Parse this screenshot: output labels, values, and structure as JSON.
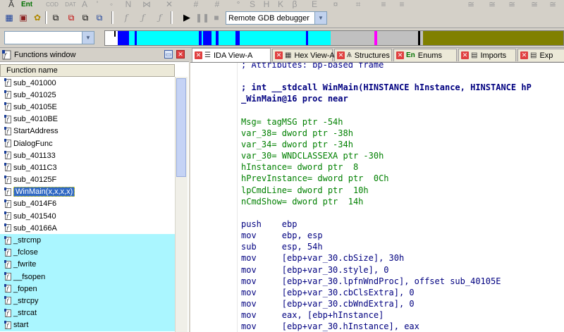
{
  "toolbar": {
    "debugger_combo": "Remote GDB debugger",
    "row1_labels": [
      "Ent",
      "COD",
      "DAT"
    ]
  },
  "functions_window": {
    "title": "Functions window",
    "column_header": "Function name",
    "items": [
      {
        "name": "sub_401000",
        "lib": false
      },
      {
        "name": "sub_401025",
        "lib": false
      },
      {
        "name": "sub_40105E",
        "lib": false
      },
      {
        "name": "sub_4010BE",
        "lib": false
      },
      {
        "name": "StartAddress",
        "lib": false
      },
      {
        "name": "DialogFunc",
        "lib": false
      },
      {
        "name": "sub_401133",
        "lib": false
      },
      {
        "name": "sub_4011C3",
        "lib": false
      },
      {
        "name": "sub_40125F",
        "lib": false
      },
      {
        "name": "WinMain(x,x,x,x)",
        "lib": false,
        "selected": true
      },
      {
        "name": "sub_4014F6",
        "lib": false
      },
      {
        "name": "sub_401540",
        "lib": false
      },
      {
        "name": "sub_40166A",
        "lib": false
      },
      {
        "name": "_strcmp",
        "lib": true
      },
      {
        "name": "_fclose",
        "lib": true
      },
      {
        "name": "_fwrite",
        "lib": true
      },
      {
        "name": "__fsopen",
        "lib": true
      },
      {
        "name": "_fopen",
        "lib": true
      },
      {
        "name": "_strcpy",
        "lib": true
      },
      {
        "name": "_strcat",
        "lib": true
      },
      {
        "name": "start",
        "lib": true
      }
    ]
  },
  "tabs": [
    {
      "label": "IDA View-A",
      "glyph": "☰",
      "active": true
    },
    {
      "label": "Hex View-A",
      "glyph": "▦",
      "active": false
    },
    {
      "label": "Structures",
      "glyph": "Ѧ",
      "active": false
    },
    {
      "label": "Enums",
      "glyph": "En",
      "active": false
    },
    {
      "label": "Imports",
      "glyph": "▤",
      "active": false
    },
    {
      "label": "Exp",
      "glyph": "▤",
      "active": false
    }
  ],
  "code": [
    {
      "text": "; Attributes: bp-based frame",
      "cls": "c-cmt"
    },
    {
      "text": "",
      "cls": ""
    },
    {
      "text": "; int __stdcall WinMain(HINSTANCE hInstance, HINSTANCE hP",
      "cls": "c-hdr"
    },
    {
      "text": "_WinMain@16 proc near",
      "cls": "c-hdr"
    },
    {
      "text": "",
      "cls": ""
    },
    {
      "text": "Msg= tagMSG ptr -54h",
      "cls": "c-var"
    },
    {
      "text": "var_38= dword ptr -38h",
      "cls": "c-var"
    },
    {
      "text": "var_34= dword ptr -34h",
      "cls": "c-var"
    },
    {
      "text": "var_30= WNDCLASSEXA ptr -30h",
      "cls": "c-var"
    },
    {
      "text": "hInstance= dword ptr  8",
      "cls": "c-var"
    },
    {
      "text": "hPrevInstance= dword ptr  0Ch",
      "cls": "c-var"
    },
    {
      "text": "lpCmdLine= dword ptr  10h",
      "cls": "c-var"
    },
    {
      "text": "nCmdShow= dword ptr  14h",
      "cls": "c-var"
    },
    {
      "text": "",
      "cls": ""
    },
    {
      "text": "push    ebp",
      "cls": "c-ins"
    },
    {
      "text": "mov     ebp, esp",
      "cls": "c-ins"
    },
    {
      "text": "sub     esp, 54h",
      "cls": "c-ins"
    },
    {
      "text": "mov     [ebp+var_30.cbSize], 30h",
      "cls": "c-ins"
    },
    {
      "text": "mov     [ebp+var_30.style], 0",
      "cls": "c-ins"
    },
    {
      "text": "mov     [ebp+var_30.lpfnWndProc], offset sub_40105E",
      "cls": "c-ins"
    },
    {
      "text": "mov     [ebp+var_30.cbClsExtra], 0",
      "cls": "c-ins"
    },
    {
      "text": "mov     [ebp+var_30.cbWndExtra], 0",
      "cls": "c-ins"
    },
    {
      "text": "mov     eax, [ebp+hInstance]",
      "cls": "c-ins"
    },
    {
      "text": "mov     [ebp+var_30.hInstance], eax",
      "cls": "c-ins"
    }
  ],
  "colors": {
    "navbar_code": "#0000ff",
    "navbar_lib": "#00ffff",
    "navbar_data": "#c0c0c0",
    "navbar_ext": "#808000",
    "navbar_marker": "#ff00ff"
  }
}
